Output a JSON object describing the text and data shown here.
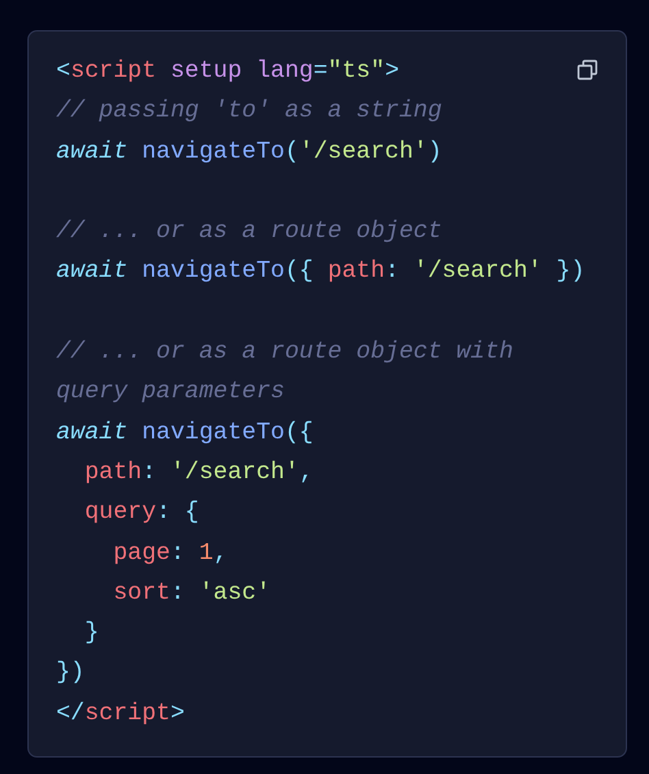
{
  "code_block": {
    "lines": [
      {
        "kind": "code",
        "tokens": [
          {
            "kind": "punct",
            "text": "<"
          },
          {
            "kind": "tag",
            "text": "script"
          },
          {
            "kind": "attr",
            "text": " setup"
          },
          {
            "kind": "attr",
            "text": " lang"
          },
          {
            "kind": "punct",
            "text": "="
          },
          {
            "kind": "string",
            "text": "\"ts\""
          },
          {
            "kind": "punct",
            "text": ">"
          }
        ]
      },
      {
        "kind": "code",
        "tokens": [
          {
            "kind": "comment",
            "text": "// passing 'to' as a string"
          }
        ]
      },
      {
        "kind": "code",
        "tokens": [
          {
            "kind": "keyword",
            "text": "await"
          },
          {
            "kind": "function",
            "text": " navigateTo"
          },
          {
            "kind": "punct",
            "text": "("
          },
          {
            "kind": "string",
            "text": "'/search'"
          },
          {
            "kind": "punct",
            "text": ")"
          }
        ]
      },
      {
        "kind": "blank"
      },
      {
        "kind": "code",
        "tokens": [
          {
            "kind": "comment",
            "text": "// ... or as a route object"
          }
        ]
      },
      {
        "kind": "code",
        "tokens": [
          {
            "kind": "keyword",
            "text": "await"
          },
          {
            "kind": "function",
            "text": " navigateTo"
          },
          {
            "kind": "punct",
            "text": "({ "
          },
          {
            "kind": "property",
            "text": "path"
          },
          {
            "kind": "punct",
            "text": ": "
          },
          {
            "kind": "string",
            "text": "'/search'"
          },
          {
            "kind": "punct",
            "text": " })"
          }
        ]
      },
      {
        "kind": "blank"
      },
      {
        "kind": "code",
        "tokens": [
          {
            "kind": "comment",
            "text": "// ... or as a route object with"
          }
        ]
      },
      {
        "kind": "code",
        "tokens": [
          {
            "kind": "comment",
            "text": "query parameters"
          }
        ]
      },
      {
        "kind": "code",
        "tokens": [
          {
            "kind": "keyword",
            "text": "await"
          },
          {
            "kind": "function",
            "text": " navigateTo"
          },
          {
            "kind": "punct",
            "text": "({"
          }
        ]
      },
      {
        "kind": "code",
        "tokens": [
          {
            "kind": "property",
            "text": "  path"
          },
          {
            "kind": "punct",
            "text": ": "
          },
          {
            "kind": "string",
            "text": "'/search'"
          },
          {
            "kind": "punct",
            "text": ","
          }
        ]
      },
      {
        "kind": "code",
        "tokens": [
          {
            "kind": "property",
            "text": "  query"
          },
          {
            "kind": "punct",
            "text": ": {"
          }
        ]
      },
      {
        "kind": "code",
        "tokens": [
          {
            "kind": "property",
            "text": "    page"
          },
          {
            "kind": "punct",
            "text": ": "
          },
          {
            "kind": "number",
            "text": "1"
          },
          {
            "kind": "punct",
            "text": ","
          }
        ]
      },
      {
        "kind": "code",
        "tokens": [
          {
            "kind": "property",
            "text": "    sort"
          },
          {
            "kind": "punct",
            "text": ": "
          },
          {
            "kind": "string",
            "text": "'asc'"
          }
        ]
      },
      {
        "kind": "code",
        "tokens": [
          {
            "kind": "punct",
            "text": "  }"
          }
        ]
      },
      {
        "kind": "code",
        "tokens": [
          {
            "kind": "punct",
            "text": "})"
          }
        ]
      },
      {
        "kind": "code",
        "tokens": [
          {
            "kind": "punct",
            "text": "</"
          },
          {
            "kind": "tag",
            "text": "script"
          },
          {
            "kind": "punct",
            "text": ">"
          }
        ]
      }
    ]
  }
}
